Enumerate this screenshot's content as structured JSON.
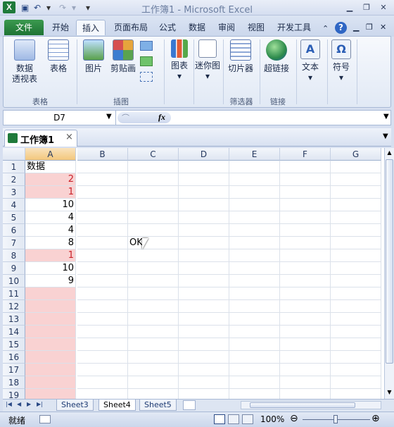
{
  "window": {
    "title": "工作簿1 - Microsoft Excel",
    "app_icon": "X",
    "undo_glyph": "↶",
    "redo_glyph": "↷",
    "customize_glyph": "▾"
  },
  "tabs": [
    "文件",
    "开始",
    "插入",
    "页面布局",
    "公式",
    "数据",
    "审阅",
    "视图",
    "开发工具"
  ],
  "ribbon": {
    "groups": [
      {
        "label": "表格",
        "buttons": [
          "数据\n透视表",
          "表格"
        ]
      },
      {
        "label": "插图",
        "buttons": [
          "图片",
          "剪贴画"
        ]
      },
      {
        "label": "",
        "buttons": [
          "图表",
          "迷你图"
        ]
      },
      {
        "label": "筛选器",
        "buttons": [
          "切片器"
        ]
      },
      {
        "label": "链接",
        "buttons": [
          "超链接"
        ]
      },
      {
        "label": "",
        "buttons": [
          "文本",
          "符号"
        ]
      }
    ],
    "dropdown_glyph": "▾"
  },
  "formula_bar": {
    "name_box": "D7",
    "fx": "fx",
    "value": ""
  },
  "workbook_tab": {
    "label": "工作簿1",
    "close": "×"
  },
  "columns": [
    "A",
    "B",
    "C",
    "D",
    "E",
    "F",
    "G"
  ],
  "rows": [
    {
      "n": "1",
      "a": "数据",
      "pink": false,
      "red": false
    },
    {
      "n": "2",
      "a": "2",
      "pink": true,
      "red": true
    },
    {
      "n": "3",
      "a": "1",
      "pink": true,
      "red": true
    },
    {
      "n": "4",
      "a": "10",
      "pink": false,
      "red": false
    },
    {
      "n": "5",
      "a": "4",
      "pink": false,
      "red": false
    },
    {
      "n": "6",
      "a": "4",
      "pink": false,
      "red": false
    },
    {
      "n": "7",
      "a": "8",
      "pink": false,
      "red": false
    },
    {
      "n": "8",
      "a": "1",
      "pink": true,
      "red": true
    },
    {
      "n": "9",
      "a": "10",
      "pink": false,
      "red": false
    },
    {
      "n": "10",
      "a": "9",
      "pink": false,
      "red": false
    },
    {
      "n": "11",
      "a": "",
      "pink": true,
      "red": false
    },
    {
      "n": "12",
      "a": "",
      "pink": true,
      "red": false
    },
    {
      "n": "13",
      "a": "",
      "pink": true,
      "red": false
    },
    {
      "n": "14",
      "a": "",
      "pink": true,
      "red": false
    },
    {
      "n": "15",
      "a": "",
      "pink": true,
      "red": false
    },
    {
      "n": "16",
      "a": "",
      "pink": true,
      "red": false
    },
    {
      "n": "17",
      "a": "",
      "pink": true,
      "red": false
    },
    {
      "n": "18",
      "a": "",
      "pink": true,
      "red": false
    },
    {
      "n": "19",
      "a": "",
      "pink": true,
      "red": false
    }
  ],
  "c7_text": "OK",
  "sheets": [
    "Sheet3",
    "Sheet4",
    "Sheet5"
  ],
  "active_sheet": "Sheet4",
  "status": {
    "ready": "就绪",
    "zoom": "100%"
  },
  "colors": {
    "pink": "#f9d2d2",
    "red": "#c8222a",
    "file_tab": "#1e7334"
  }
}
